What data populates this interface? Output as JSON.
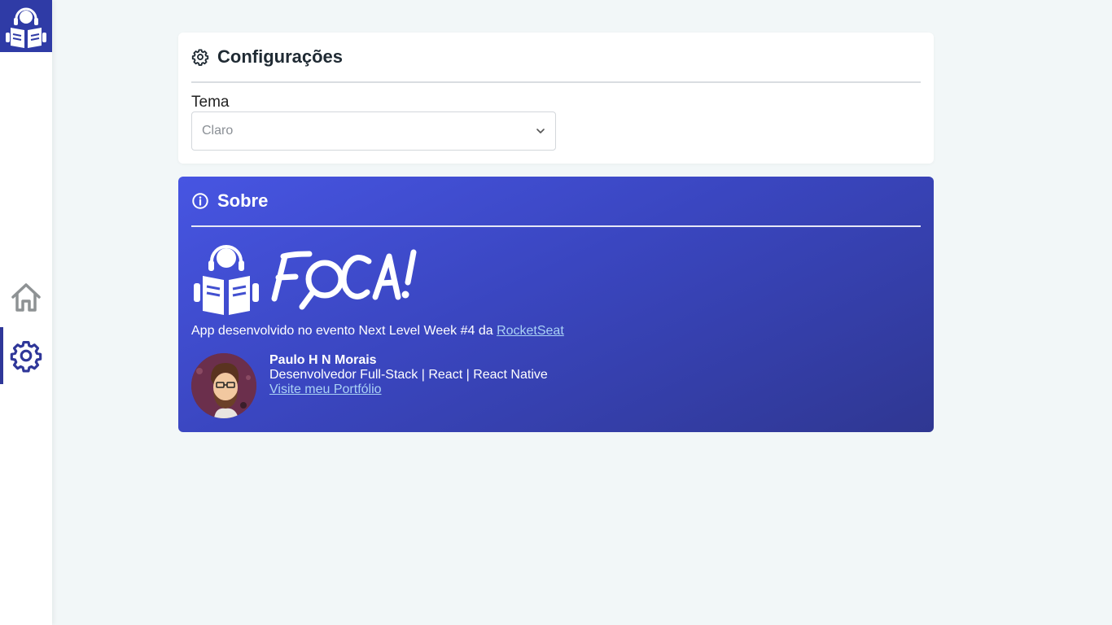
{
  "sidebar": {
    "logo_icon": "reader-headphones-icon",
    "items": [
      {
        "name": "home",
        "icon": "home-icon",
        "active": false
      },
      {
        "name": "settings",
        "icon": "gear-icon",
        "active": true
      }
    ]
  },
  "config": {
    "title": "Configurações",
    "icon": "gear-icon",
    "theme_label": "Tema",
    "theme_value": "Claro"
  },
  "about": {
    "title": "Sobre",
    "icon": "info-icon",
    "brand_text": "FOCA!",
    "description": "App desenvolvido no evento Next Level Week #4 da ",
    "link_label": "RocketSeat",
    "developer": {
      "name": "Paulo H N Morais",
      "role": "Desenvolvedor Full-Stack | React | React Native",
      "portfolio_label": "Visite meu Portfólio"
    }
  },
  "colors": {
    "brand": "#2f3ba6",
    "gradient_start": "#4755e2",
    "gradient_end": "#2f3792",
    "link": "#aad2f5",
    "background": "#f2f7f8"
  }
}
